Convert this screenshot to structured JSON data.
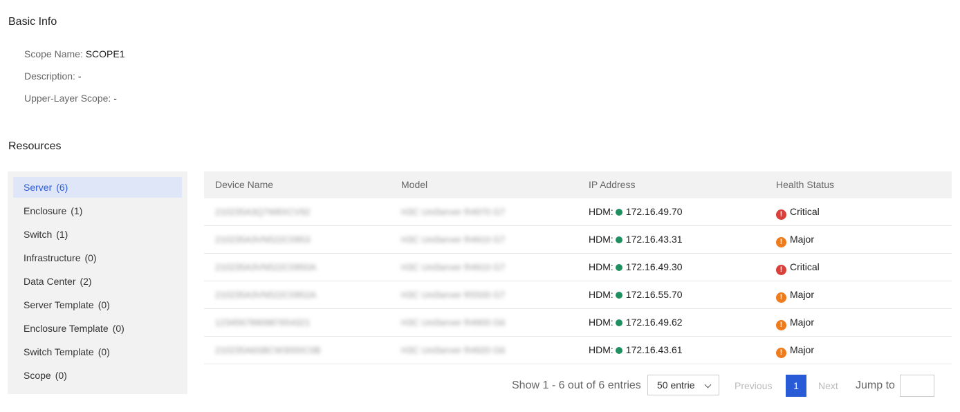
{
  "basic_info": {
    "title": "Basic Info",
    "scope_name_label": "Scope Name:",
    "scope_name_value": "SCOPE1",
    "description_label": "Description:",
    "description_value": "-",
    "upper_layer_label": "Upper-Layer Scope:",
    "upper_layer_value": "-"
  },
  "resources": {
    "title": "Resources",
    "categories": [
      {
        "label": "Server",
        "count": "(6)",
        "active": true
      },
      {
        "label": "Enclosure",
        "count": "(1)"
      },
      {
        "label": "Switch",
        "count": "(1)"
      },
      {
        "label": "Infrastructure",
        "count": "(0)"
      },
      {
        "label": "Data Center",
        "count": "(2)"
      },
      {
        "label": "Server Template",
        "count": "(0)"
      },
      {
        "label": "Enclosure Template",
        "count": "(0)"
      },
      {
        "label": "Switch Template",
        "count": "(0)"
      },
      {
        "label": "Scope",
        "count": "(0)"
      }
    ]
  },
  "table": {
    "headers": {
      "device_name": "Device Name",
      "model": "Model",
      "ip_address": "IP Address",
      "health_status": "Health Status"
    },
    "ip_prefix": "HDM:",
    "rows": [
      {
        "device_name": "210235A3Q7W8XCV92",
        "model": "H3C UniServer R4970 G7",
        "ip": "172.16.49.70",
        "health": "Critical",
        "health_level": "critical"
      },
      {
        "device_name": "210235A3VN522C0953",
        "model": "H3C UniServer R4910 G7",
        "ip": "172.16.43.31",
        "health": "Major",
        "health_level": "major"
      },
      {
        "device_name": "210235A3VN522C0950A",
        "model": "H3C UniServer R4910 G7",
        "ip": "172.16.49.30",
        "health": "Critical",
        "health_level": "critical"
      },
      {
        "device_name": "210235A3VN522C0952A",
        "model": "H3C UniServer R5500 G7",
        "ip": "172.16.55.70",
        "health": "Major",
        "health_level": "major"
      },
      {
        "device_name": "1234567890987654321",
        "model": "H3C UniServer R4900 G6",
        "ip": "172.16.49.62",
        "health": "Major",
        "health_level": "major"
      },
      {
        "device_name": "210235A6SBCW3000C0B",
        "model": "H3C UniServer R4920 G6",
        "ip": "172.16.43.61",
        "health": "Major",
        "health_level": "major"
      }
    ]
  },
  "pagination": {
    "summary": "Show 1 - 6 out of 6 entries",
    "page_size": "50 entrie",
    "previous": "Previous",
    "current_page": "1",
    "next": "Next",
    "jump_to": "Jump to",
    "jump_value": ""
  },
  "colors": {
    "accent": "#2a5bd7",
    "active_bg": "#dfe6f7",
    "online": "#1f8f5e",
    "critical": "#d9403a",
    "major": "#ee7b1c"
  }
}
